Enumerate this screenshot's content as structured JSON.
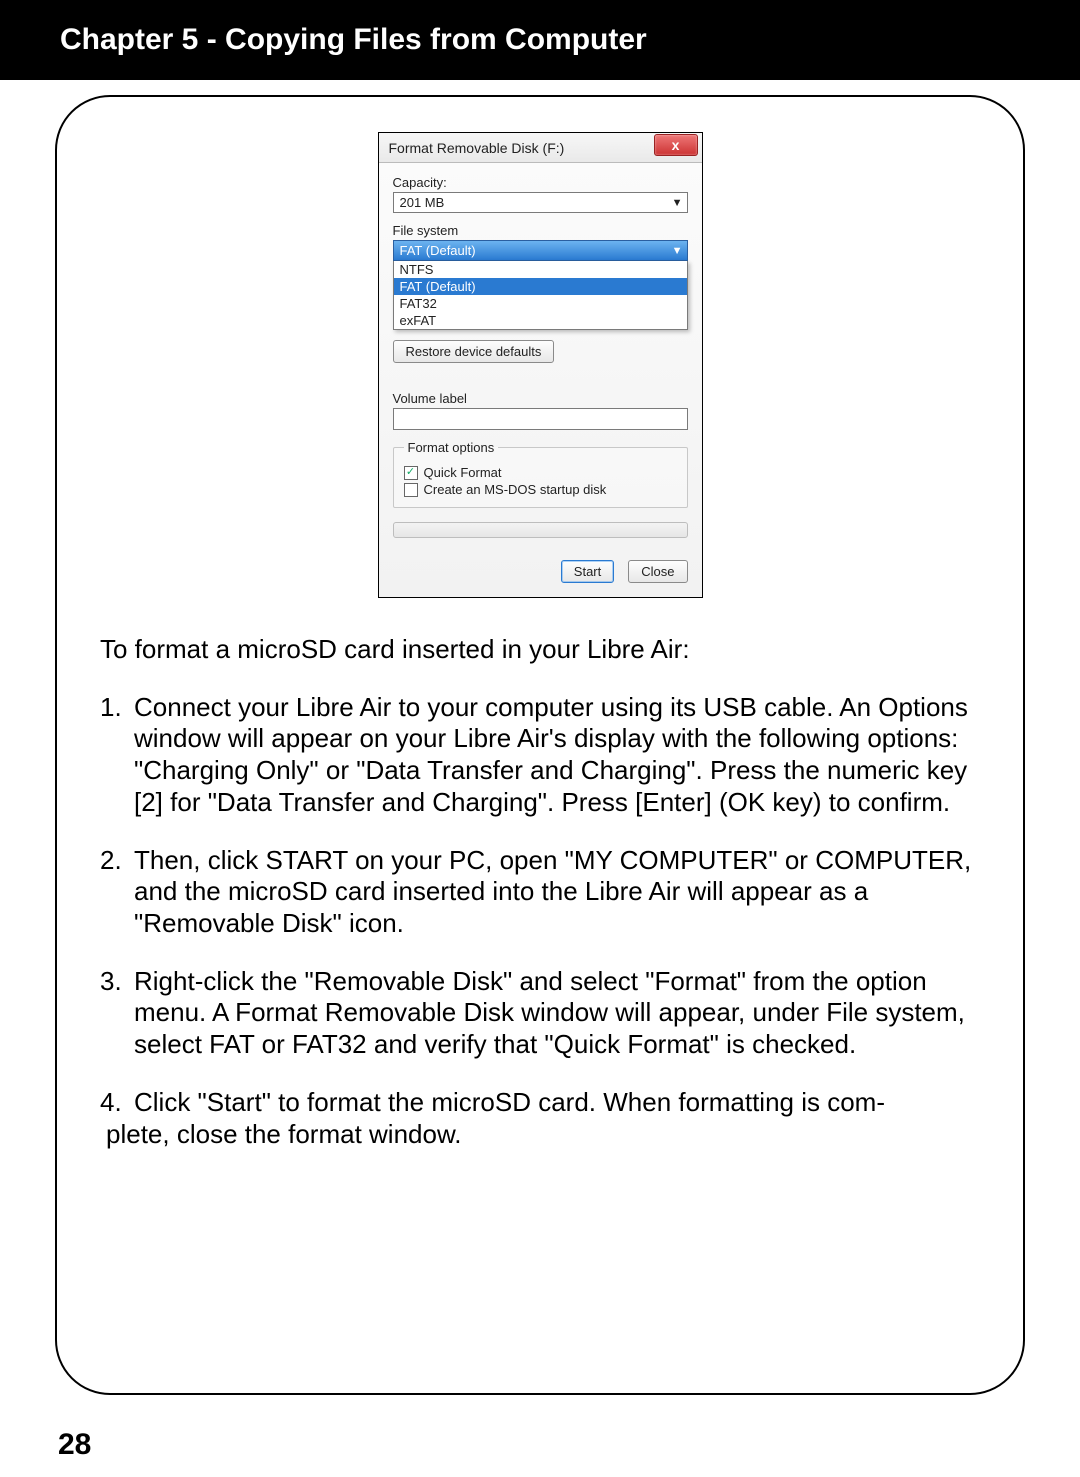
{
  "header": {
    "title": "Chapter 5 - Copying Files from Computer"
  },
  "page_number": "28",
  "dialog": {
    "title": "Format Removable Disk (F:)",
    "close_icon_label": "x",
    "capacity_label": "Capacity:",
    "capacity_value": "201 MB",
    "filesystem_label": "File system",
    "filesystem_value": "FAT (Default)",
    "filesystem_options": [
      "NTFS",
      "FAT (Default)",
      "FAT32",
      "exFAT"
    ],
    "filesystem_selected_index": 1,
    "restore_button": "Restore device defaults",
    "volume_label_label": "Volume label",
    "volume_label_value": "",
    "format_options_legend": "Format options",
    "quick_format_label": "Quick Format",
    "quick_format_checked": true,
    "msdos_label": "Create an MS-DOS startup disk",
    "msdos_checked": false,
    "start_button": "Start",
    "close_button": "Close"
  },
  "text": {
    "intro": "To format a microSD card inserted in your Libre Air:",
    "steps": [
      "Connect your Libre Air to your computer using its USB cable. An Options window will appear on your Libre Air's display with the following options:  \"Charging Only\" or \"Data Transfer and Charging\". Press the numeric key [2] for \"Data Transfer and Charging\". Press [Enter] (OK key) to confirm.",
      "Then, click START on your PC, open \"MY COMPUTER\" or COMPUTER, and the microSD card inserted into the Libre Air will appear as a \"Removable Disk\" icon.",
      "Right-click the \"Removable Disk\" and select \"Format\" from the option menu. A Format Removable Disk window will appear, under File system, select FAT or FAT32 and verify that \"Quick Format\" is checked.",
      "Click \"Start\" to format the microSD card.  When formatting is complete, close the format window."
    ],
    "step4_line1": "Click \"Start\" to format the microSD card.  When formatting is com-",
    "step4_rest": "plete, close the format window."
  }
}
